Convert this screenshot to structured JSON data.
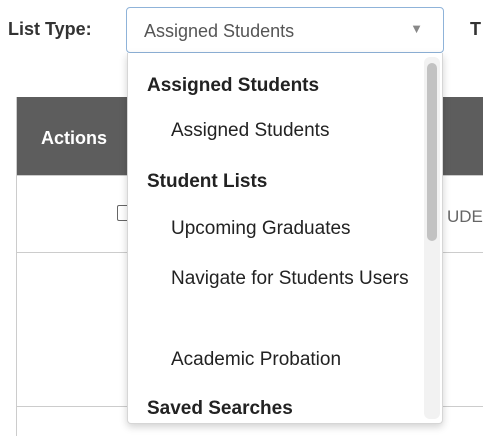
{
  "filter": {
    "label": "List Type:",
    "selected_value": "Assigned Students",
    "arrow": "▼",
    "next_label_fragment": "T"
  },
  "table": {
    "header_actions": "Actions",
    "row_text_fragment": "UDE"
  },
  "dropdown": {
    "groups": [
      {
        "label": "Assigned Students",
        "options": [
          "Assigned Students"
        ]
      },
      {
        "label": "Student Lists",
        "options": [
          "Upcoming Graduates",
          "Navigate for Students Users",
          "Academic Probation"
        ]
      },
      {
        "label": "Saved Searches",
        "options": []
      }
    ]
  }
}
